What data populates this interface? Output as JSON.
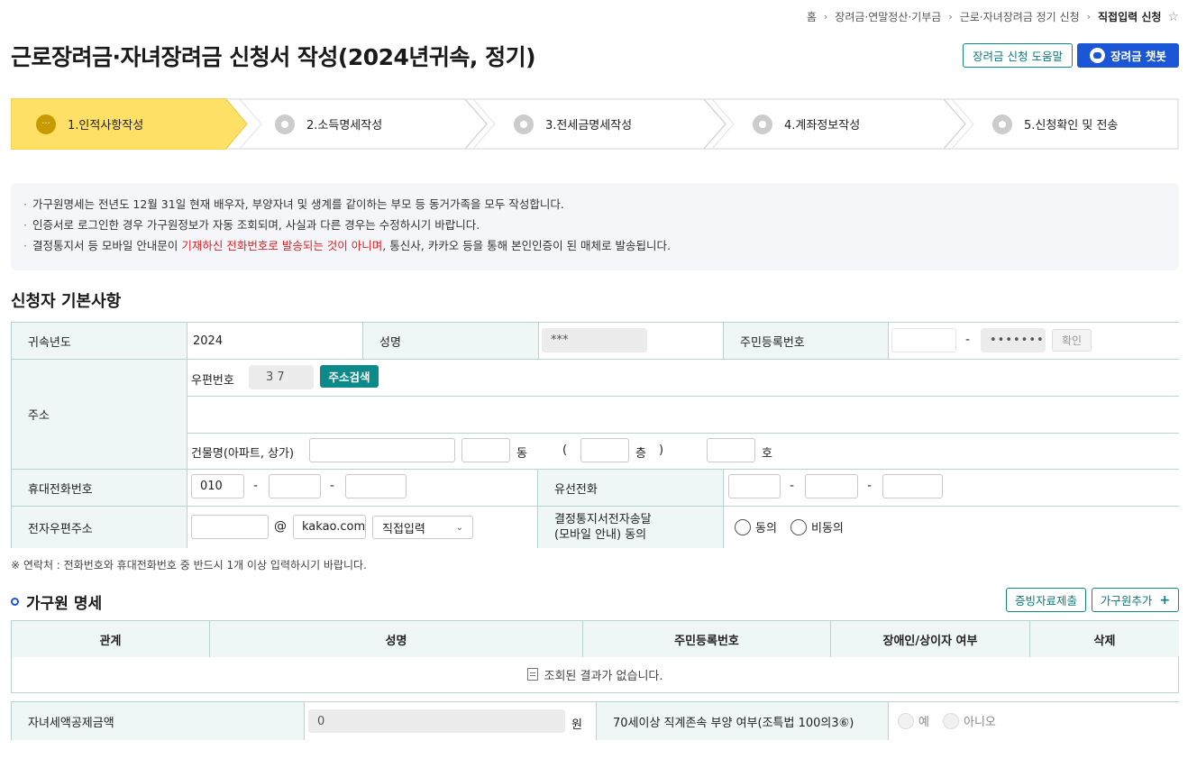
{
  "breadcrumb": {
    "home": "홈",
    "level1": "장려금·연말정산·기부금",
    "level2": "근로·자녀장려금 정기 신청",
    "current": "직접입력 신청",
    "star_icon": "☆"
  },
  "page_title": "근로장려금·자녀장려금 신청서 작성(2024년귀속, 정기)",
  "header_buttons": {
    "help": "장려금 신청 도움말",
    "chatbot": "장려금 챗봇"
  },
  "steps": [
    {
      "label": "1.인적사항작성",
      "state": "active"
    },
    {
      "label": "2.소득명세작성",
      "state": "pending"
    },
    {
      "label": "3.전세금명세작성",
      "state": "pending"
    },
    {
      "label": "4.계좌정보작성",
      "state": "pending"
    },
    {
      "label": "5.신청확인 및 전송",
      "state": "pending"
    }
  ],
  "active_step_dots": "···",
  "notice": {
    "line1": "가구원명세는 전년도 12월 31일 현재 배우자, 부양자녀 및 생계를 같이하는 부모 등 동거가족을 모두 작성합니다.",
    "line2": "인증서로 로그인한 경우 가구원정보가 자동 조회되며, 사실과 다른 경우는 수정하시기 바랍니다.",
    "line3_prefix": "결정통지서 등 모바일 안내문이 ",
    "line3_highlight": "기재하신 전화번호로 발송되는 것이 아니며",
    "line3_suffix": ", 통신사, 카카오 등을 통해 본인인증이 된 매체로 발송됩니다."
  },
  "section_title": "신청자 기본사항",
  "form": {
    "year_label": "귀속년도",
    "year_value": "2024",
    "name_label": "성명",
    "name_value": "***",
    "rrn_label": "주민등록번호",
    "rrn_back": "•••••••",
    "confirm_btn": "확인",
    "address_label": "주소",
    "postal_label": "우편번호",
    "postal_value": "3     7",
    "address_search_btn": "주소검색",
    "building_label": "건물명(아파트, 상가)",
    "dong_label": "동",
    "paren_open": "(",
    "floor_label": "층",
    "paren_close": ")",
    "ho_label": "호",
    "mobile_label": "휴대전화번호",
    "mobile_prefix": "010",
    "landline_label": "유선전화",
    "email_label": "전자우편주소",
    "email_at": "@",
    "email_domain": "kakao.com",
    "email_select": "직접입력",
    "consent_label_1": "결정통지서전자송달",
    "consent_label_2": "(모바일 안내) 동의",
    "agree": "동의",
    "disagree": "비동의",
    "dash": "-"
  },
  "contact_note": "※ 연락처 : 전화번호와 휴대전화번호 중 반드시 1개 이상 입력하시기 바랍니다.",
  "family": {
    "title": "가구원 명세",
    "proof_btn": "증빙자료제출",
    "add_btn": "가구원추가",
    "add_icon": "+",
    "columns": [
      "관계",
      "성명",
      "주민등록번호",
      "장애인/상이자 여부",
      "삭제"
    ],
    "empty_message": "조회된 결과가 없습니다."
  },
  "child_tax": {
    "label": "자녀세액공제금액",
    "value": "0",
    "unit": "원",
    "elder_label": "70세이상 직계존속 부양 여부(조특법 100의3⑥)",
    "yes": "예",
    "no": "아니오"
  },
  "colors": {
    "accent_teal": "#0c8a8a",
    "chatbot_blue": "#1a56d6",
    "active_step": "#ffe066",
    "header_cell": "#eef7f6",
    "highlight_red": "#e02020"
  }
}
